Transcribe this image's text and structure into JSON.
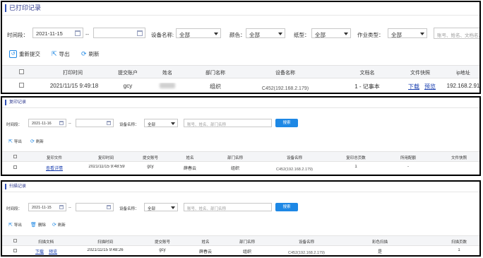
{
  "print_panel": {
    "title": "已打印记录",
    "filters": {
      "time_label": "时间段：",
      "date_from": "2021-11-15",
      "range_sep": "--",
      "date_to": "",
      "device_label": "设备名称:",
      "device_value": "全部",
      "color_label": "颜色：",
      "color_value": "全部",
      "paper_label": "纸型：",
      "paper_value": "全部",
      "jobtype_label": "作业类型：",
      "jobtype_value": "全部",
      "search_placeholder": "账号、姓名、文档名,"
    },
    "toolbar": {
      "resubmit": "重新提交",
      "export": "导出",
      "refresh": "刷新"
    },
    "columns": [
      "打印时间",
      "提交账户",
      "姓名",
      "部门名称",
      "设备名称",
      "文档名",
      "文件快照",
      "ip地址"
    ],
    "rows": [
      {
        "time": "2021/11/15 9:49:18",
        "account": "gcy",
        "name": "",
        "dept": "组织",
        "device": "C452(192.168.2.179)",
        "doc": "1 - 记事本",
        "snap_download": "下载",
        "snap_preview": "预览",
        "ip": "192.168.2.91"
      }
    ]
  },
  "copy_panel": {
    "title": "复印记录",
    "filters": {
      "time_label": "时间段：",
      "date_from": "2021-11-16",
      "range_sep": "--",
      "date_to": "",
      "device_label": "设备名称：",
      "device_value": "全部",
      "search_placeholder": "账号、姓名、部门名称",
      "search_button": "搜索"
    },
    "toolbar": {
      "export": "导出",
      "refresh": "刷新"
    },
    "columns": [
      "复印文件",
      "复印时间",
      "提交账号",
      "姓名",
      "部门名称",
      "设备名称",
      "复印总页数",
      "所用配额",
      "文件快照"
    ],
    "rows": [
      {
        "file_link": "查看详情",
        "time": "2021/11/15 9:48:59",
        "account": "gcy",
        "name": "薛春云",
        "dept": "组织",
        "device": "C452(192.168.2.179)",
        "pages": "1",
        "quota": "-",
        "snapshot": ""
      }
    ]
  },
  "scan_panel": {
    "title": "扫描记录",
    "filters": {
      "time_label": "时间段：",
      "date_from": "2021-11-15",
      "range_sep": "--",
      "date_to": "",
      "device_label": "设备名称：",
      "device_value": "全部",
      "search_placeholder": "账号、姓名、部门名称",
      "search_button": "搜索"
    },
    "toolbar": {
      "export": "导出",
      "delete": "删除",
      "refresh": "刷新"
    },
    "columns": [
      "扫描文档",
      "扫描时间",
      "提交账号",
      "姓名",
      "部门名称",
      "设备名称",
      "彩色扫描",
      "扫描页数"
    ],
    "rows": [
      {
        "doc_download": "下载",
        "doc_preview": "预览",
        "time": "2021/11/15 9:48:26",
        "account": "gcy",
        "name": "薛春云",
        "dept": "组织",
        "device": "C452(192.168.2.179)",
        "color": "是",
        "pages": "1"
      }
    ]
  },
  "colors": {
    "accent": "#1e88e5",
    "link": "#1a3fb0",
    "title": "#2f3a8f",
    "border": "#000000"
  }
}
